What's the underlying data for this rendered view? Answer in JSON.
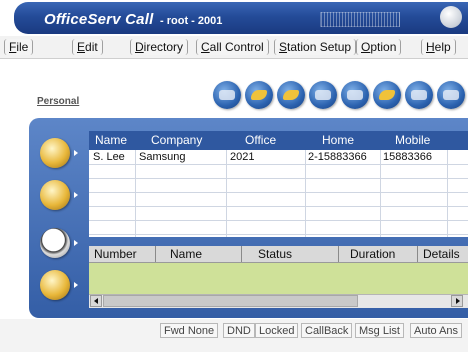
{
  "window": {
    "app_name": "OfficeServ Call",
    "subtitle": "- root - 2001"
  },
  "menu": [
    "File",
    "Edit",
    "Directory",
    "Call Control",
    "Station Setup",
    "Option",
    "Help"
  ],
  "toolbar": {
    "tab_label": "Personal"
  },
  "directory": {
    "columns": [
      "Name",
      "Company",
      "Office",
      "Home",
      "Mobile"
    ],
    "rows": [
      {
        "name": "S. Lee",
        "company": "Samsung",
        "office": "2021",
        "home": "2-15883366",
        "mobile": "15883366"
      }
    ]
  },
  "calls": {
    "columns": [
      "Number",
      "Name",
      "Status",
      "Duration",
      "Details"
    ]
  },
  "status": [
    "Fwd None",
    "DND",
    "Locked",
    "CallBack",
    "Msg List",
    "Auto Ans"
  ],
  "colors": {
    "title_bar": "#244b98",
    "panel": "#345ea6",
    "header": "#2f58a0",
    "call_list_bg": "#cfe199"
  }
}
